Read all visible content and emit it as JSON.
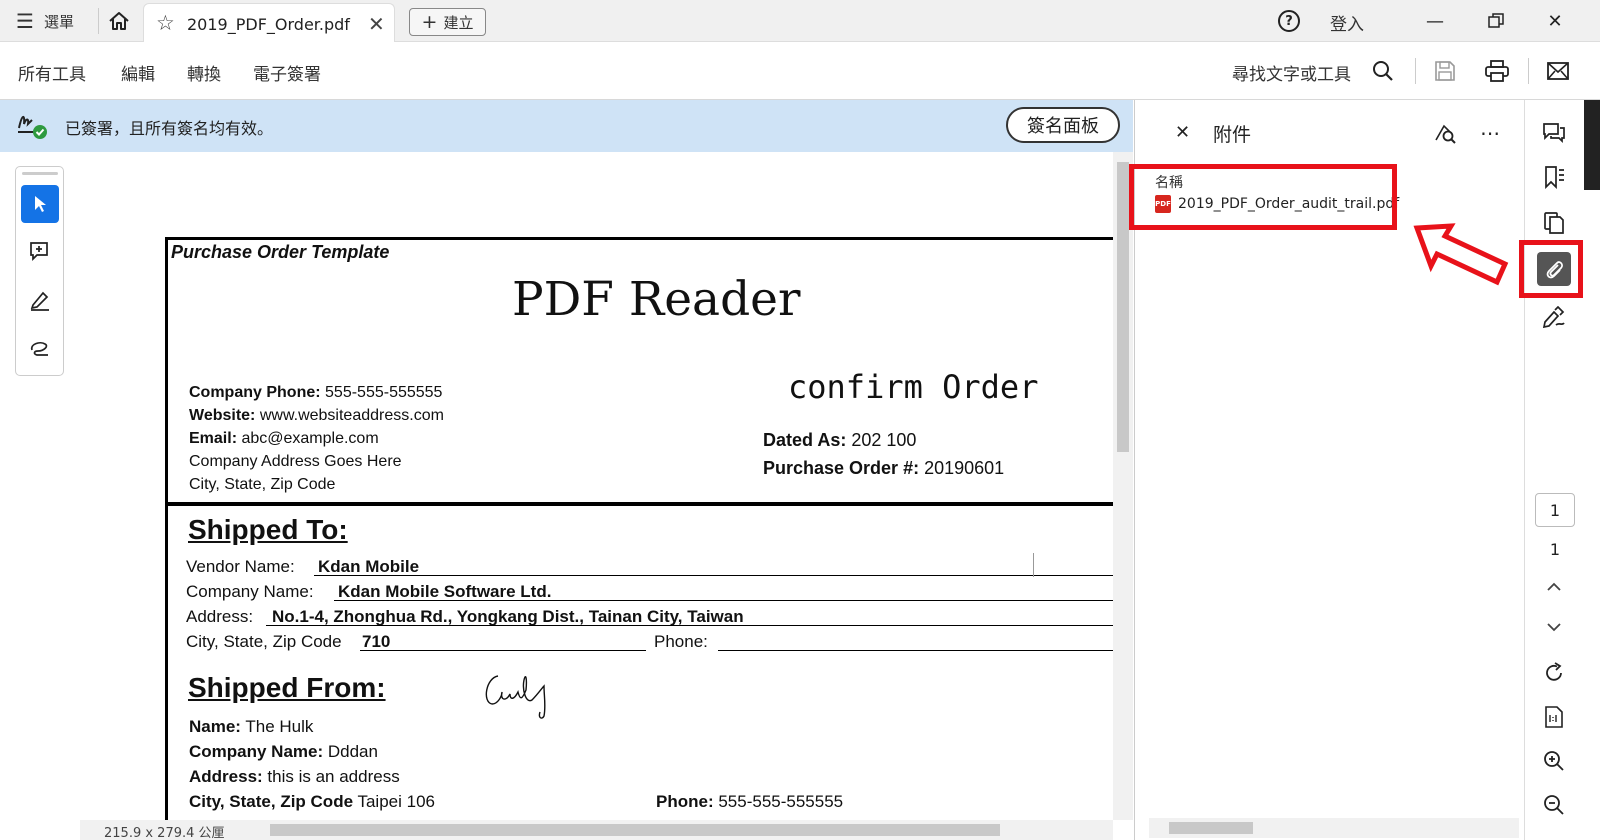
{
  "titlebar": {
    "menu_label": "選單",
    "tab_title": "2019_PDF_Order.pdf",
    "new_label": "建立",
    "help_symbol": "?",
    "sign_in": "登入"
  },
  "toolbar": {
    "menu_items": [
      "所有工具",
      "編輯",
      "轉換",
      "電子簽署"
    ],
    "search_label": "尋找文字或工具"
  },
  "signature_banner": {
    "message": "已簽署，且所有簽名均有效。",
    "panel_button": "簽名面板"
  },
  "document": {
    "template_title": "Purchase Order Template",
    "heading": "PDF Reader",
    "confirm": "confirm  Order",
    "company_phone_label": "Company Phone:",
    "company_phone": "555-555-555555",
    "website_label": "Website:",
    "website": "www.websiteaddress.com",
    "email_label": "Email:",
    "email": "abc@example.com",
    "address_line1": "Company Address Goes Here",
    "address_line2": "City, State, Zip Code",
    "dated_label": "Dated As:",
    "dated_value": "202  100",
    "po_label": "Purchase Order #:",
    "po_value": "20190601",
    "shipped_to": "Shipped To:",
    "vendor_label": "Vendor Name:",
    "vendor_value": "Kdan Mobile",
    "company_name_label": "Company Name:",
    "company_name_value": "Kdan Mobile Software Ltd.",
    "address_label": "Address:",
    "address_value": "No.1-4, Zhonghua Rd., Yongkang Dist., Tainan City, Taiwan",
    "city_label": "City, State, Zip Code",
    "city_value": "710",
    "phone_label": "Phone:",
    "shipped_from": "Shipped From:",
    "from_name_label": "Name:",
    "from_name_value": "The Hulk",
    "from_company_label": "Company Name:",
    "from_company_value": "Dddan",
    "from_address_label": "Address:",
    "from_address_value": "this is an address",
    "from_city_label": "City, State, Zip Code",
    "from_city_value": "Taipei  106",
    "from_phone_label": "Phone:",
    "from_phone_value": "555-555-555555"
  },
  "status": {
    "page_dimensions": "215.9 x 279.4 公厘"
  },
  "attachments_panel": {
    "title": "附件",
    "column_header": "名稱",
    "items": [
      {
        "name": "2019_PDF_Order_audit_trail.pdf",
        "icon": "pdf-file-icon"
      }
    ]
  },
  "page_nav": {
    "current_page": "1",
    "total_pages": "1"
  },
  "colors": {
    "accent": "#1473e6",
    "banner_bg": "#cfe3f6",
    "highlight_red": "#e8121a",
    "pdf_red": "#d7261e"
  }
}
